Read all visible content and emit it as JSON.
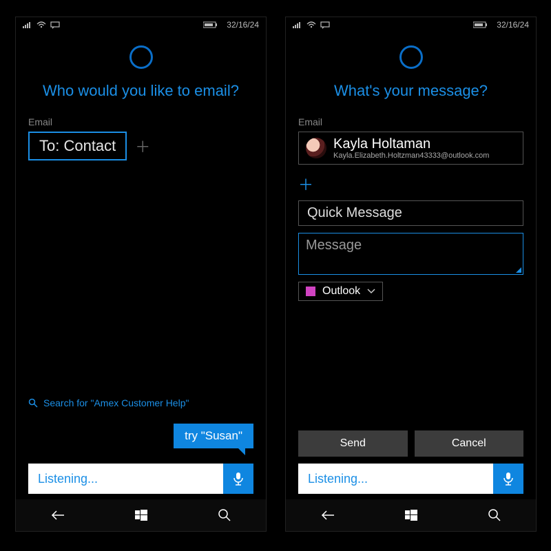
{
  "status": {
    "time": "32/16/24"
  },
  "left": {
    "prompt": "Who would you like to email?",
    "section_label": "Email",
    "to_field": "To: Contact",
    "search_hint": "Search for \"Amex Customer Help\"",
    "suggestion": "try \"Susan\"",
    "listening": "Listening..."
  },
  "right": {
    "prompt": "What's your message?",
    "section_label": "Email",
    "contact": {
      "name": "Kayla Holtaman",
      "address": "Kayla.Elizabeth.Holtzman43333@outlook.com"
    },
    "subject_placeholder": "Quick Message",
    "message_placeholder": "Message",
    "account": {
      "name": "Outlook",
      "color": "#d043c1"
    },
    "send_label": "Send",
    "cancel_label": "Cancel",
    "listening": "Listening..."
  }
}
